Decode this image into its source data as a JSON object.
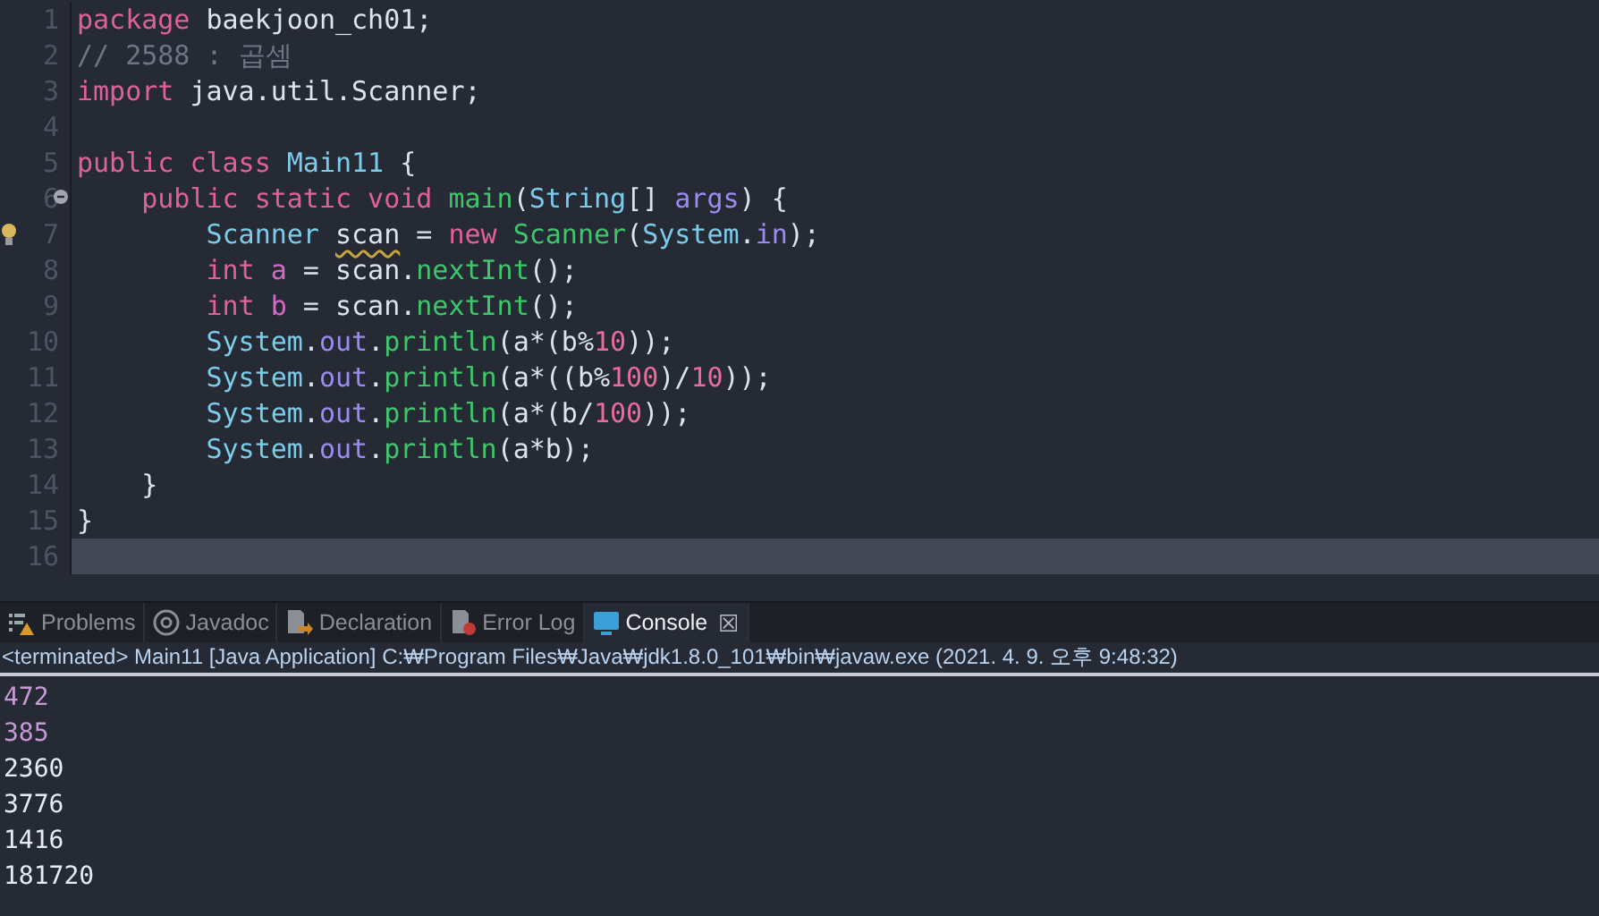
{
  "editor": {
    "lines": [
      {
        "number": "1",
        "kind": "plain",
        "current": false,
        "tokens": [
          {
            "text": "package ",
            "kind": "keyword"
          },
          {
            "text": "baekjoon_ch01;",
            "kind": "plain"
          }
        ]
      },
      {
        "number": "2",
        "kind": "plain",
        "current": false,
        "tokens": [
          {
            "text": "// 2588 : 곱셈",
            "kind": "comment"
          }
        ]
      },
      {
        "number": "3",
        "kind": "plain",
        "current": false,
        "tokens": [
          {
            "text": "import ",
            "kind": "keyword"
          },
          {
            "text": "java.util.Scanner;",
            "kind": "plain"
          }
        ]
      },
      {
        "number": "4",
        "kind": "plain",
        "current": false
      },
      {
        "number": "5",
        "kind": "plain",
        "current": false,
        "tokens": [
          {
            "text": "public class ",
            "kind": "keyword"
          },
          {
            "text": "Main11",
            "kind": "type"
          },
          {
            "text": " {",
            "kind": "plain"
          }
        ]
      },
      {
        "number": "6",
        "kind": "fold",
        "current": false,
        "tokens": [
          {
            "text": "    public static void ",
            "kind": "keyword"
          },
          {
            "text": "main",
            "kind": "method"
          },
          {
            "text": "(",
            "kind": "plain"
          },
          {
            "text": "String",
            "kind": "type"
          },
          {
            "text": "[] ",
            "kind": "plain"
          },
          {
            "text": "args",
            "kind": "field"
          },
          {
            "text": ") {",
            "kind": "plain"
          }
        ]
      },
      {
        "number": "7",
        "kind": "hint",
        "current": false,
        "tokens": [
          {
            "text": "        Scanner ",
            "kind": "type"
          },
          {
            "text": "scan",
            "kind": "warning"
          },
          {
            "text": " = ",
            "kind": "plain"
          },
          {
            "text": "new ",
            "kind": "keyword"
          },
          {
            "text": "Scanner",
            "kind": "method"
          },
          {
            "text": "(",
            "kind": "plain"
          },
          {
            "text": "System",
            "kind": "type"
          },
          {
            "text": ".",
            "kind": "plain"
          },
          {
            "text": "in",
            "kind": "field"
          },
          {
            "text": ");",
            "kind": "plain"
          }
        ]
      },
      {
        "number": "8",
        "kind": "plain",
        "current": false,
        "tokens": [
          {
            "text": "        int ",
            "kind": "keyword"
          },
          {
            "text": "a",
            "kind": "local"
          },
          {
            "text": " = scan.",
            "kind": "plain"
          },
          {
            "text": "nextInt",
            "kind": "method"
          },
          {
            "text": "();",
            "kind": "plain"
          }
        ]
      },
      {
        "number": "9",
        "kind": "plain",
        "current": false,
        "tokens": [
          {
            "text": "        int ",
            "kind": "keyword"
          },
          {
            "text": "b",
            "kind": "local"
          },
          {
            "text": " = scan.",
            "kind": "plain"
          },
          {
            "text": "nextInt",
            "kind": "method"
          },
          {
            "text": "();",
            "kind": "plain"
          }
        ]
      },
      {
        "number": "10",
        "kind": "plain",
        "current": false,
        "tokens": [
          {
            "text": "        System",
            "kind": "type"
          },
          {
            "text": ".",
            "kind": "plain"
          },
          {
            "text": "out",
            "kind": "field"
          },
          {
            "text": ".",
            "kind": "plain"
          },
          {
            "text": "println",
            "kind": "method"
          },
          {
            "text": "(a*(b%",
            "kind": "plain"
          },
          {
            "text": "10",
            "kind": "number"
          },
          {
            "text": "));",
            "kind": "plain"
          }
        ]
      },
      {
        "number": "11",
        "kind": "plain",
        "current": false,
        "tokens": [
          {
            "text": "        System",
            "kind": "type"
          },
          {
            "text": ".",
            "kind": "plain"
          },
          {
            "text": "out",
            "kind": "field"
          },
          {
            "text": ".",
            "kind": "plain"
          },
          {
            "text": "println",
            "kind": "method"
          },
          {
            "text": "(a*((b%",
            "kind": "plain"
          },
          {
            "text": "100",
            "kind": "number"
          },
          {
            "text": ")/",
            "kind": "plain"
          },
          {
            "text": "10",
            "kind": "number"
          },
          {
            "text": "));",
            "kind": "plain"
          }
        ]
      },
      {
        "number": "12",
        "kind": "plain",
        "current": false,
        "tokens": [
          {
            "text": "        System",
            "kind": "type"
          },
          {
            "text": ".",
            "kind": "plain"
          },
          {
            "text": "out",
            "kind": "field"
          },
          {
            "text": ".",
            "kind": "plain"
          },
          {
            "text": "println",
            "kind": "method"
          },
          {
            "text": "(a*(b/",
            "kind": "plain"
          },
          {
            "text": "100",
            "kind": "number"
          },
          {
            "text": "));",
            "kind": "plain"
          }
        ]
      },
      {
        "number": "13",
        "kind": "plain",
        "current": false,
        "tokens": [
          {
            "text": "        System",
            "kind": "type"
          },
          {
            "text": ".",
            "kind": "plain"
          },
          {
            "text": "out",
            "kind": "field"
          },
          {
            "text": ".",
            "kind": "plain"
          },
          {
            "text": "println",
            "kind": "method"
          },
          {
            "text": "(a*b);",
            "kind": "plain"
          }
        ]
      },
      {
        "number": "14",
        "kind": "plain",
        "current": false,
        "tokens": [
          {
            "text": "    }",
            "kind": "plain"
          }
        ]
      },
      {
        "number": "15",
        "kind": "plain",
        "current": false,
        "tokens": [
          {
            "text": "}",
            "kind": "plain"
          }
        ]
      },
      {
        "number": "16",
        "kind": "plain",
        "current": true
      }
    ]
  },
  "panel": {
    "tabs": [
      {
        "label": "Problems",
        "selected": false
      },
      {
        "label": "Javadoc",
        "selected": false
      },
      {
        "label": "Declaration",
        "selected": false
      },
      {
        "label": "Error Log",
        "selected": false
      },
      {
        "label": "Console",
        "selected": true,
        "close": "☒"
      }
    ],
    "status": "<terminated> Main11 [Java Application] C:₩Program Files₩Java₩jdk1.8.0_101₩bin₩javaw.exe (2021. 4. 9. 오후 9:48:32)",
    "output": [
      {
        "text": "472",
        "kind": "input"
      },
      {
        "text": "385",
        "kind": "input"
      },
      {
        "text": "2360",
        "kind": "output"
      },
      {
        "text": "3776",
        "kind": "output"
      },
      {
        "text": "1416",
        "kind": "output"
      },
      {
        "text": "181720",
        "kind": "output"
      }
    ]
  }
}
